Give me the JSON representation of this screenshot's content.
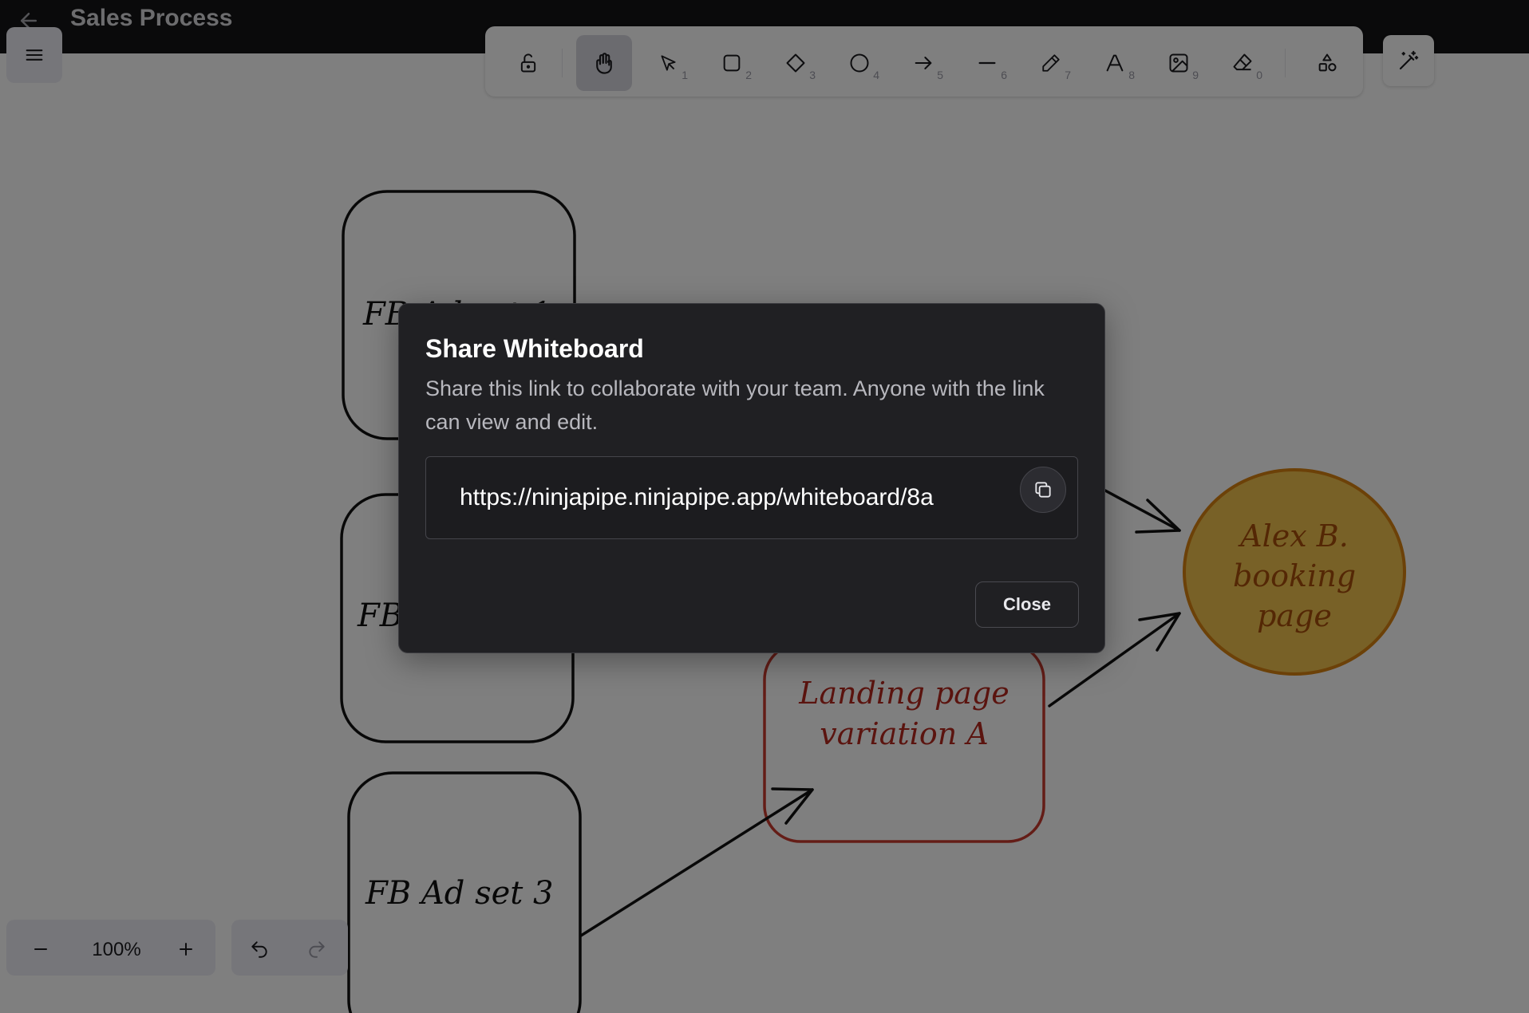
{
  "header": {
    "title": "Sales Process",
    "back_icon": "arrow-left-icon"
  },
  "toolbar": {
    "tools": [
      {
        "name": "lock",
        "icon": "lock-open-icon",
        "shortcut": ""
      },
      {
        "name": "hand",
        "icon": "hand-icon",
        "shortcut": "",
        "active": true
      },
      {
        "name": "selection",
        "icon": "pointer-icon",
        "shortcut": "1"
      },
      {
        "name": "rectangle",
        "icon": "square-icon",
        "shortcut": "2"
      },
      {
        "name": "diamond",
        "icon": "diamond-icon",
        "shortcut": "3"
      },
      {
        "name": "ellipse",
        "icon": "circle-icon",
        "shortcut": "4"
      },
      {
        "name": "arrow",
        "icon": "arrow-right-icon",
        "shortcut": "5"
      },
      {
        "name": "line",
        "icon": "line-icon",
        "shortcut": "6"
      },
      {
        "name": "draw",
        "icon": "pencil-icon",
        "shortcut": "7"
      },
      {
        "name": "text",
        "icon": "text-icon",
        "shortcut": "8"
      },
      {
        "name": "image",
        "icon": "image-icon",
        "shortcut": "9"
      },
      {
        "name": "eraser",
        "icon": "eraser-icon",
        "shortcut": "0"
      },
      {
        "name": "shapes",
        "icon": "shapes-icon",
        "shortcut": ""
      }
    ]
  },
  "canvas": {
    "boxes": [
      {
        "label": "FB Ad set 1"
      },
      {
        "label": "FB Ad set 2"
      },
      {
        "label": "FB Ad set 3"
      }
    ],
    "landing": {
      "line1": "Landing page",
      "line2": "variation A"
    },
    "booking": {
      "line1": "Alex B.",
      "line2": "booking",
      "line3": "page"
    }
  },
  "zoom": {
    "value": "100%"
  },
  "dialog": {
    "title": "Share Whiteboard",
    "description": "Share this link to collaborate with your team. Anyone with the link can view and edit.",
    "link": "https://ninjapipe.ninjapipe.app/whiteboard/8a",
    "close_label": "Close"
  }
}
